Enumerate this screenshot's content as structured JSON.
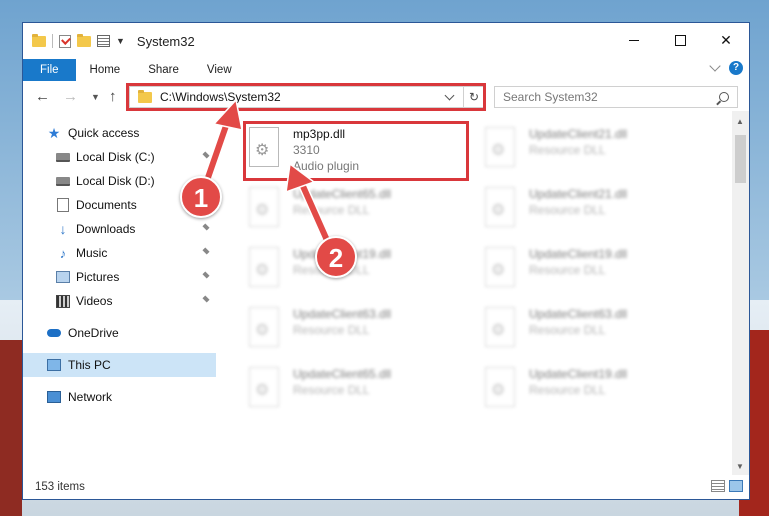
{
  "window": {
    "title": "System32"
  },
  "ribbon": {
    "tabs": [
      "File",
      "Home",
      "Share",
      "View"
    ]
  },
  "address_bar": {
    "path": "C:\\Windows\\System32"
  },
  "search": {
    "placeholder": "Search System32"
  },
  "sidebar": {
    "items": [
      {
        "label": "Quick access",
        "icon": "star-icon",
        "pinned": false
      },
      {
        "label": "Local Disk (C:)",
        "icon": "drive-icon",
        "pinned": true
      },
      {
        "label": "Local Disk (D:)",
        "icon": "drive-icon",
        "pinned": false
      },
      {
        "label": "Documents",
        "icon": "documents-icon",
        "pinned": false
      },
      {
        "label": "Downloads",
        "icon": "download-icon",
        "pinned": true
      },
      {
        "label": "Music",
        "icon": "music-icon",
        "pinned": true
      },
      {
        "label": "Pictures",
        "icon": "pictures-icon",
        "pinned": true
      },
      {
        "label": "Videos",
        "icon": "videos-icon",
        "pinned": true
      },
      {
        "label": "OneDrive",
        "icon": "cloud-icon",
        "pinned": false
      },
      {
        "label": "This PC",
        "icon": "computer-icon",
        "pinned": false,
        "selected": true
      },
      {
        "label": "Network",
        "icon": "network-icon",
        "pinned": false
      }
    ]
  },
  "files": {
    "highlighted": {
      "name": "mp3pp.dll",
      "size": "3310",
      "type": "Audio plugin"
    },
    "blurred": [
      {
        "name": "UpdateClient21.dll",
        "type": "Resource DLL"
      },
      {
        "name": "UpdateClient65.dll",
        "type": "Resource DLL"
      },
      {
        "name": "UpdateClient21.dll",
        "type": "Resource DLL"
      },
      {
        "name": "UpdateClient19.dll",
        "type": "Resource DLL"
      },
      {
        "name": "UpdateClient19.dll",
        "type": "Resource DLL"
      },
      {
        "name": "UpdateClient63.dll",
        "type": "Resource DLL"
      },
      {
        "name": "UpdateClient63.dll",
        "type": "Resource DLL"
      },
      {
        "name": "UpdateClient65.dll",
        "type": "Resource DLL"
      },
      {
        "name": "UpdateClient19.dll",
        "type": "Resource DLL"
      }
    ]
  },
  "status": {
    "item_count": "153 items"
  },
  "callouts": {
    "step1": "1",
    "step2": "2"
  },
  "colors": {
    "accent": "#1979ca",
    "highlight": "#d9373b",
    "selected": "#cce4f7"
  }
}
